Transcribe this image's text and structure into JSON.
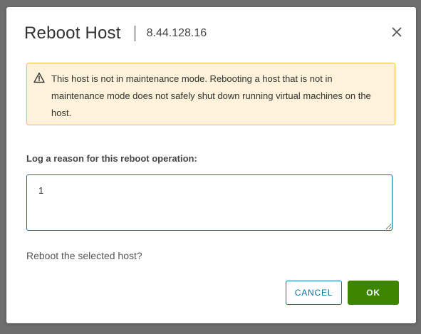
{
  "dialog": {
    "title": "Reboot Host",
    "subtitle": "8.44.128.16",
    "close_icon": "close-icon"
  },
  "alert": {
    "icon": "warning-triangle-icon",
    "message": "This host is not in maintenance mode. Rebooting a host that is not in maintenance mode does not safely shut down running virtual machines on the host.",
    "colors": {
      "background": "#fef3da",
      "border": "#f1c046"
    }
  },
  "reason": {
    "label": "Log a reason for this reboot operation:",
    "value": "1"
  },
  "confirm_text": "Reboot the selected host?",
  "buttons": {
    "cancel_label": "CANCEL",
    "ok_label": "OK"
  },
  "colors": {
    "primary": "#0072a3",
    "success": "#3c8500"
  }
}
